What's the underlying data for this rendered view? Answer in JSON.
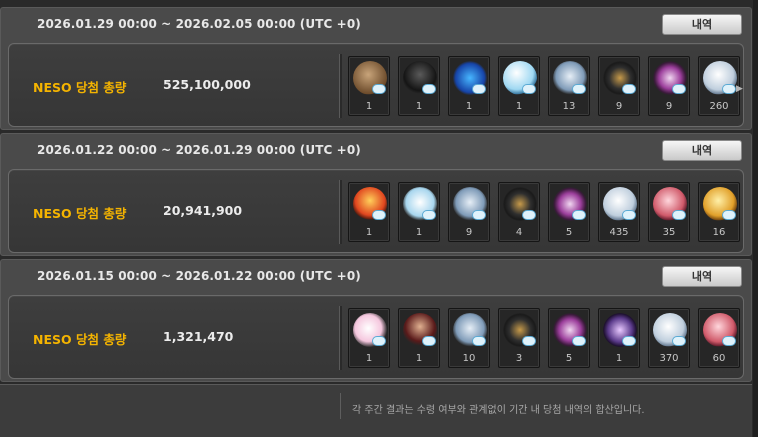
{
  "button_label": "내역",
  "neso_label": "NESO 당첨 총량",
  "weeks": [
    {
      "period": "2026.01.29 00:00 ~ 2026.02.05 00:00 (UTC +0)",
      "amount": "525,100,000",
      "items": [
        {
          "icon": "ic-brown",
          "name": "item-icon-bag-figure",
          "qty": "1"
        },
        {
          "icon": "ic-dark",
          "name": "item-icon-dark-figure",
          "qty": "1"
        },
        {
          "icon": "ic-blue",
          "name": "item-icon-blue-flame",
          "qty": "1"
        },
        {
          "icon": "ic-orb",
          "name": "item-icon-white-orb",
          "qty": "1"
        },
        {
          "icon": "ic-chest",
          "name": "item-icon-silver-chest",
          "qty": "13"
        },
        {
          "icon": "ic-emblem",
          "name": "item-icon-emblem",
          "qty": "9"
        },
        {
          "icon": "ic-pink",
          "name": "item-icon-pink-disc",
          "qty": "9"
        },
        {
          "icon": "ic-white",
          "name": "item-icon-white-sphere",
          "qty": "260"
        }
      ]
    },
    {
      "period": "2026.01.22 00:00 ~ 2026.01.29 00:00 (UTC +0)",
      "amount": "20,941,900",
      "items": [
        {
          "icon": "ic-fire",
          "name": "item-icon-fire",
          "qty": "1"
        },
        {
          "icon": "ic-wing",
          "name": "item-icon-winged-crest",
          "qty": "1"
        },
        {
          "icon": "ic-chest",
          "name": "item-icon-silver-chest",
          "qty": "9"
        },
        {
          "icon": "ic-emblem",
          "name": "item-icon-emblem",
          "qty": "4"
        },
        {
          "icon": "ic-pink",
          "name": "item-icon-pink-disc",
          "qty": "5"
        },
        {
          "icon": "ic-white",
          "name": "item-icon-white-sphere",
          "qty": "435"
        },
        {
          "icon": "ic-rose",
          "name": "item-icon-rose-sphere",
          "qty": "35"
        },
        {
          "icon": "ic-gold",
          "name": "item-icon-gold-coin",
          "qty": "16"
        }
      ]
    },
    {
      "period": "2026.01.15 00:00 ~ 2026.01.22 00:00 (UTC +0)",
      "amount": "1,321,470",
      "items": [
        {
          "icon": "ic-flower",
          "name": "item-icon-flower",
          "qty": "1"
        },
        {
          "icon": "ic-warrior",
          "name": "item-icon-warrior",
          "qty": "1"
        },
        {
          "icon": "ic-chest",
          "name": "item-icon-silver-chest",
          "qty": "10"
        },
        {
          "icon": "ic-emblem",
          "name": "item-icon-emblem",
          "qty": "3"
        },
        {
          "icon": "ic-pink",
          "name": "item-icon-pink-disc",
          "qty": "5"
        },
        {
          "icon": "ic-purple",
          "name": "item-icon-purple-crystal",
          "qty": "1"
        },
        {
          "icon": "ic-white",
          "name": "item-icon-white-sphere",
          "qty": "370"
        },
        {
          "icon": "ic-rose",
          "name": "item-icon-rose-sphere",
          "qty": "60"
        }
      ]
    }
  ],
  "footer_note": "각 주간 결과는 수령 여부와 관계없이 기간 내 당첨 내역의 합산입니다."
}
